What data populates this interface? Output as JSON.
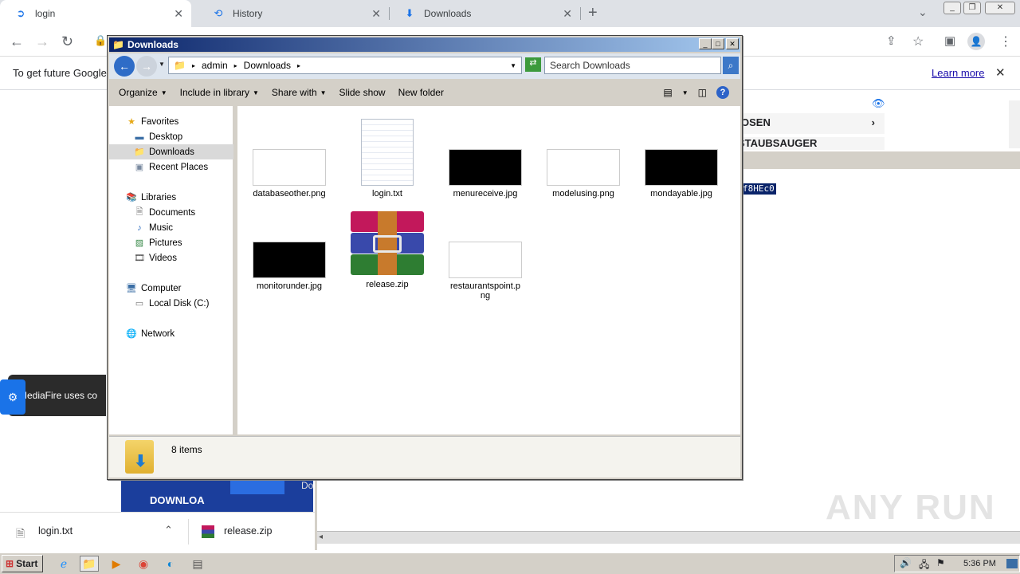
{
  "browser": {
    "tabs": [
      {
        "label": "login",
        "icon": "mediafire-icon"
      },
      {
        "label": "History",
        "icon": "history-icon"
      },
      {
        "label": "Downloads",
        "icon": "download-icon"
      }
    ],
    "new_tab": "+",
    "infobar_text": "To get future Google",
    "learn_more": "Learn more"
  },
  "page": {
    "menu_item_1": "OSEN",
    "menu_item_2": "STAUBSAUGER",
    "highlighted_text": "f8HEc0",
    "cookie_text": "MediaFire uses co",
    "download_label": "DOWNLOA",
    "do_text": "Do"
  },
  "downloads_bar": {
    "items": [
      {
        "name": "login.txt"
      },
      {
        "name": "release.zip"
      }
    ]
  },
  "explorer": {
    "title": "Downloads",
    "breadcrumb": [
      "admin",
      "Downloads"
    ],
    "search_placeholder": "Search Downloads",
    "commands": [
      "Organize",
      "Include in library",
      "Share with",
      "Slide show",
      "New folder"
    ],
    "nav": {
      "favorites_header": "Favorites",
      "favorites": [
        "Desktop",
        "Downloads",
        "Recent Places"
      ],
      "libraries_header": "Libraries",
      "libraries": [
        "Documents",
        "Music",
        "Pictures",
        "Videos"
      ],
      "computer_header": "Computer",
      "computer": [
        "Local Disk (C:)"
      ],
      "network": "Network"
    },
    "files": [
      {
        "name": "databaseother.png",
        "thumb": "white"
      },
      {
        "name": "login.txt",
        "thumb": "text"
      },
      {
        "name": "menureceive.jpg",
        "thumb": "black"
      },
      {
        "name": "modelusing.png",
        "thumb": "white"
      },
      {
        "name": "mondayable.jpg",
        "thumb": "black"
      },
      {
        "name": "monitorunder.jpg",
        "thumb": "black"
      },
      {
        "name": "release.zip",
        "thumb": "winrar"
      },
      {
        "name": "restaurantspoint.png",
        "thumb": "white"
      }
    ],
    "status": "8 items"
  },
  "taskbar": {
    "start": "Start",
    "clock": "5:36 PM"
  },
  "watermark": "ANY RUN"
}
